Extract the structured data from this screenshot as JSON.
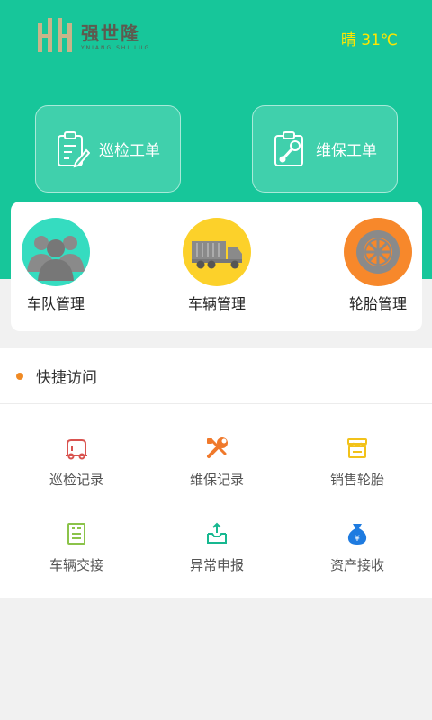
{
  "header": {
    "brand_name": "强世隆",
    "brand_sub": "YNIANG SHI LUG",
    "weather": "晴 31℃"
  },
  "actions": {
    "inspection_order": "巡检工单",
    "maintenance_order": "维保工单"
  },
  "features": [
    {
      "label": "车队管理",
      "icon": "fleet-people-icon"
    },
    {
      "label": "车辆管理",
      "icon": "truck-icon"
    },
    {
      "label": "轮胎管理",
      "icon": "tire-icon"
    }
  ],
  "quick_access": {
    "title": "快捷访问",
    "items": [
      {
        "label": "巡检记录",
        "icon": "truck-outline-icon",
        "color": "#d9534f"
      },
      {
        "label": "维保记录",
        "icon": "tools-icon",
        "color": "#f0792b"
      },
      {
        "label": "销售轮胎",
        "icon": "store-icon",
        "color": "#f2c21a"
      },
      {
        "label": "车辆交接",
        "icon": "document-icon",
        "color": "#8bc34a"
      },
      {
        "label": "异常申报",
        "icon": "upload-box-icon",
        "color": "#17b890"
      },
      {
        "label": "资产接收",
        "icon": "money-bag-icon",
        "color": "#1e7be0"
      }
    ]
  },
  "colors": {
    "brand_green": "#17c69a",
    "weather_yellow": "#ffe600",
    "accent_orange": "#f08a24"
  }
}
